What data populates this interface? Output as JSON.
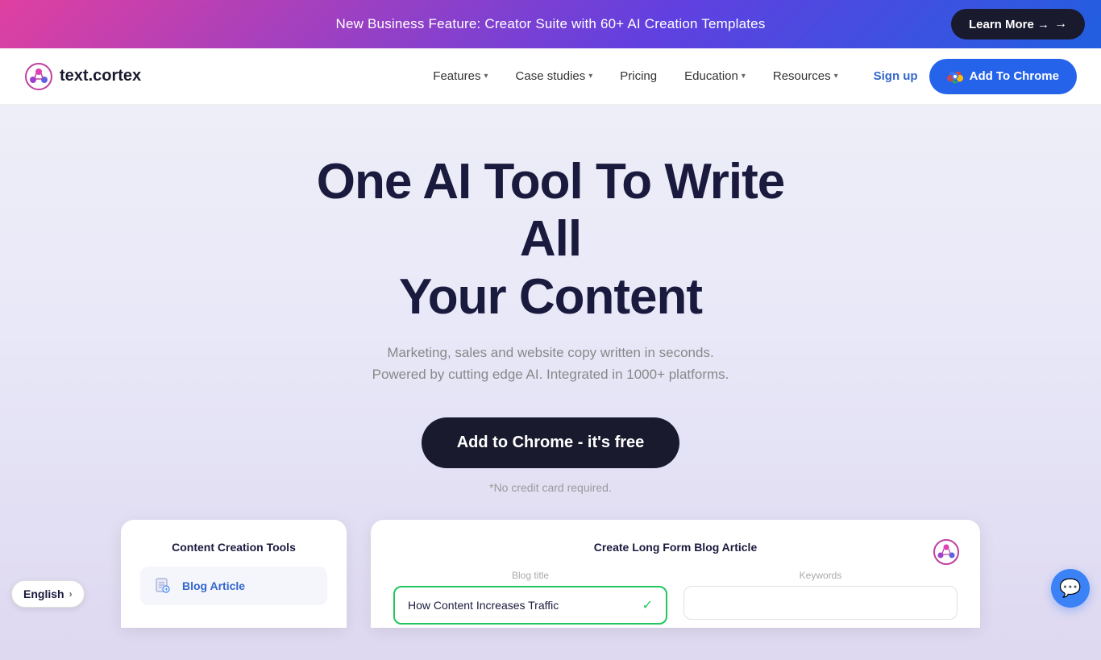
{
  "banner": {
    "text": "New Business Feature: Creator Suite with 60+ AI Creation Templates",
    "learn_more": "Learn More →"
  },
  "navbar": {
    "logo_text": "text.cortex",
    "nav_items": [
      {
        "label": "Features",
        "has_dropdown": true
      },
      {
        "label": "Case studies",
        "has_dropdown": true
      },
      {
        "label": "Pricing",
        "has_dropdown": false
      },
      {
        "label": "Education",
        "has_dropdown": true
      },
      {
        "label": "Resources",
        "has_dropdown": true
      }
    ],
    "sign_up": "Sign up",
    "add_to_chrome": "Add To Chrome"
  },
  "hero": {
    "title_line1": "One AI Tool To Write All",
    "title_line2": "Your Content",
    "subtitle_line1": "Marketing, sales and website copy written in seconds.",
    "subtitle_line2": "Powered by cutting edge AI. Integrated in 1000+ platforms.",
    "cta": "Add to Chrome - it's free",
    "no_cc": "*No credit card required."
  },
  "card1": {
    "title": "Content Creation Tools",
    "item_label": "Blog Article"
  },
  "card2": {
    "title": "Create Long Form Blog Article",
    "blog_title_label": "Blog title",
    "blog_title_value": "How Content Increases Traffic",
    "keywords_label": "Keywords",
    "keywords_placeholder": ""
  },
  "lang": {
    "label": "English"
  }
}
